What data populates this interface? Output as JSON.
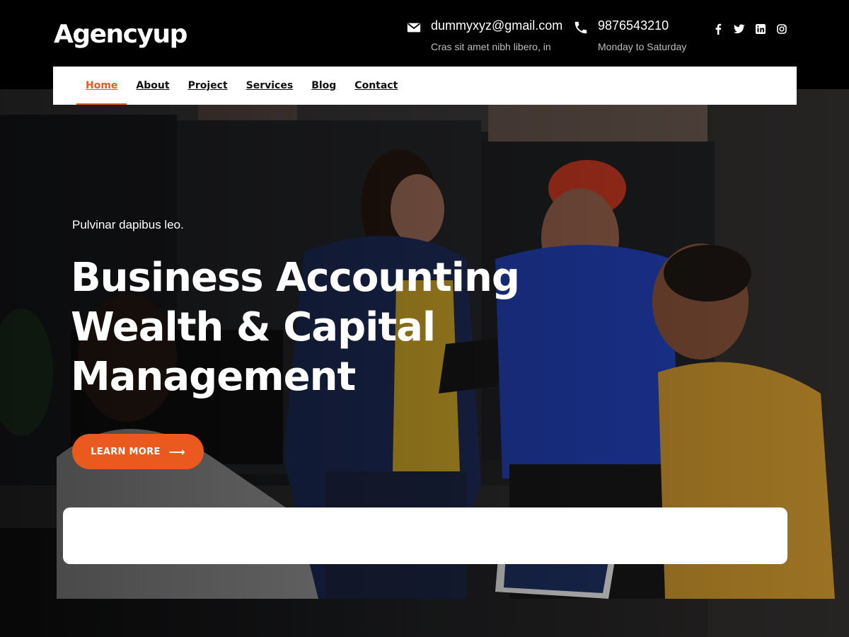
{
  "brand": {
    "name": "Agencyup"
  },
  "header": {
    "email": {
      "value": "dummyxyz@gmail.com",
      "sub": "Cras sit amet nibh libero, in",
      "icon": "envelope-icon"
    },
    "phone": {
      "value": "9876543210",
      "sub": "Monday to Saturday",
      "icon": "phone-icon"
    },
    "social": [
      {
        "icon": "facebook-icon",
        "glyph": "f"
      },
      {
        "icon": "twitter-icon",
        "glyph": "t"
      },
      {
        "icon": "linkedin-icon",
        "glyph": "in"
      },
      {
        "icon": "instagram-icon",
        "glyph": "ig"
      }
    ]
  },
  "nav": {
    "items": [
      {
        "label": "Home",
        "active": true
      },
      {
        "label": "About"
      },
      {
        "label": "Project"
      },
      {
        "label": "Services"
      },
      {
        "label": "Blog"
      },
      {
        "label": "Contact"
      }
    ]
  },
  "hero": {
    "eyebrow": "Pulvinar dapibus leo.",
    "headline": [
      "Business Accounting",
      "Wealth & Capital",
      "Management"
    ],
    "cta_label": "LEARN MORE",
    "cta_icon": "arrow-right-icon"
  },
  "colors": {
    "accent": "#ea5a1f",
    "topbar": "#000000",
    "nav_bg": "#ffffff"
  }
}
